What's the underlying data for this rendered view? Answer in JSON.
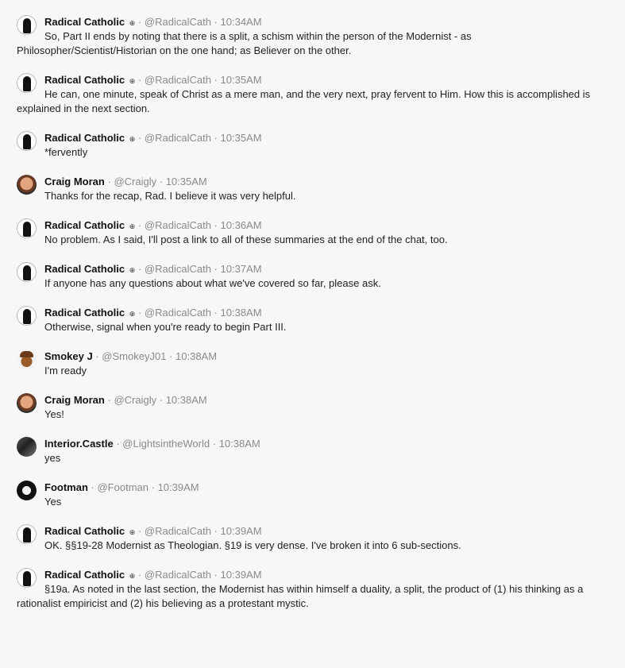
{
  "messages": [
    {
      "name": "Radical Catholic",
      "badge": "⊕",
      "handle": "@RadicalCath",
      "time": "10:34AM",
      "avatar": "rad",
      "text": "So, Part II ends by noting that there is a split, a schism within the person of the Modernist - as Philosopher/Scientist/Historian on the one hand; as Believer on the other."
    },
    {
      "name": "Radical Catholic",
      "badge": "⊕",
      "handle": "@RadicalCath",
      "time": "10:35AM",
      "avatar": "rad",
      "text": "He can, one minute, speak of Christ as a mere man, and the very next, pray fervent to Him. How this is accomplished is explained in the next section."
    },
    {
      "name": "Radical Catholic",
      "badge": "⊕",
      "handle": "@RadicalCath",
      "time": "10:35AM",
      "avatar": "rad",
      "text": "*fervently"
    },
    {
      "name": "Craig Moran",
      "badge": "",
      "handle": "@Craigly",
      "time": "10:35AM",
      "avatar": "craig",
      "text": "Thanks for the recap, Rad. I believe it was very helpful."
    },
    {
      "name": "Radical Catholic",
      "badge": "⊕",
      "handle": "@RadicalCath",
      "time": "10:36AM",
      "avatar": "rad",
      "text": "No problem. As I said, I'll post a link to all of these summaries at the end of the chat, too."
    },
    {
      "name": "Radical Catholic",
      "badge": "⊕",
      "handle": "@RadicalCath",
      "time": "10:37AM",
      "avatar": "rad",
      "text": "If anyone has any questions about what we've covered so far, please ask."
    },
    {
      "name": "Radical Catholic",
      "badge": "⊕",
      "handle": "@RadicalCath",
      "time": "10:38AM",
      "avatar": "rad",
      "text": "Otherwise, signal when you're ready to begin Part III."
    },
    {
      "name": "Smokey J",
      "badge": "",
      "handle": "@SmokeyJ01",
      "time": "10:38AM",
      "avatar": "smokey",
      "text": "I'm ready"
    },
    {
      "name": "Craig Moran",
      "badge": "",
      "handle": "@Craigly",
      "time": "10:38AM",
      "avatar": "craig",
      "text": "Yes!"
    },
    {
      "name": "Interior.Castle",
      "badge": "",
      "handle": "@LightsintheWorld",
      "time": "10:38AM",
      "avatar": "castle",
      "text": "yes"
    },
    {
      "name": "Footman",
      "badge": "",
      "handle": "@Footman",
      "time": "10:39AM",
      "avatar": "footman",
      "text": "Yes"
    },
    {
      "name": "Radical Catholic",
      "badge": "⊕",
      "handle": "@RadicalCath",
      "time": "10:39AM",
      "avatar": "rad",
      "text": "OK. §§19-28 Modernist as Theologian. §19 is very dense. I've broken it into 6 sub-sections."
    },
    {
      "name": "Radical Catholic",
      "badge": "⊕",
      "handle": "@RadicalCath",
      "time": "10:39AM",
      "avatar": "rad",
      "text": "§19a. As noted in the last section, the Modernist has within himself a duality, a split, the product of (1) his thinking as a rationalist empiricist and (2) his believing as a protestant mystic."
    }
  ]
}
